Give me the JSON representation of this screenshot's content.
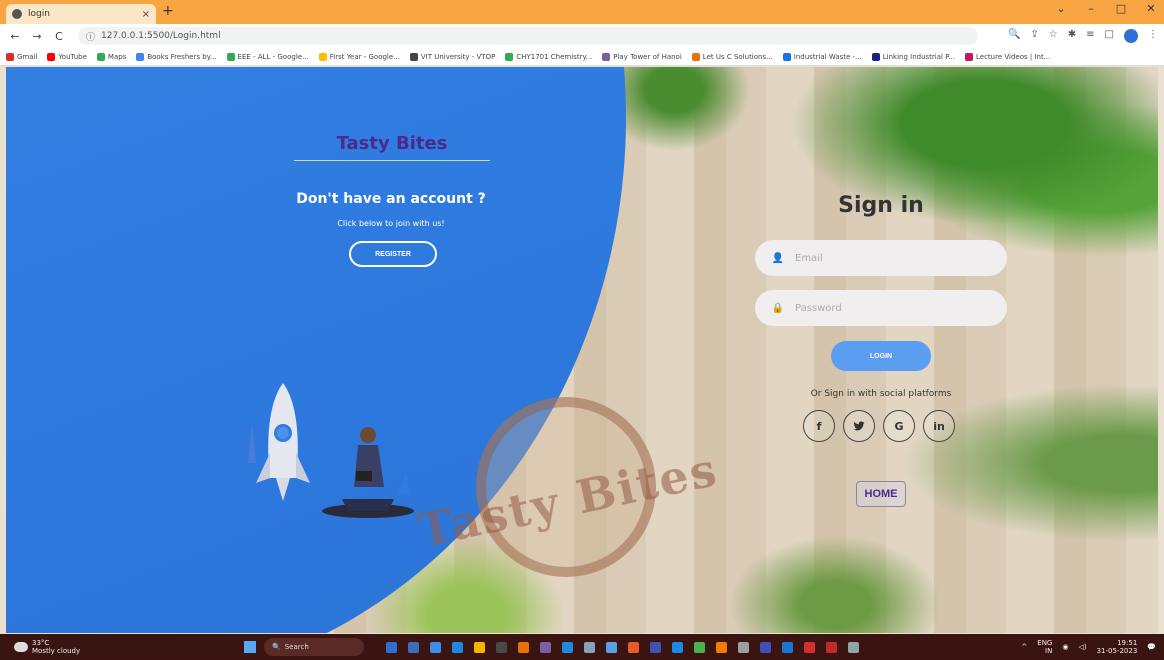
{
  "browser": {
    "tab_title": "login",
    "tab_close": "×",
    "new_tab": "+",
    "url": "127.0.0.1:5500/Login.html",
    "window_controls": [
      "⌄",
      "–",
      "□",
      "✕"
    ],
    "bookmarks": [
      {
        "label": "Gmail",
        "color": "#d93025"
      },
      {
        "label": "YouTube",
        "color": "#ff0000"
      },
      {
        "label": "Maps",
        "color": "#34a853"
      },
      {
        "label": "Books Freshers by...",
        "color": "#4285f4"
      },
      {
        "label": "EEE - ALL - Google...",
        "color": "#34a853"
      },
      {
        "label": "First Year - Google...",
        "color": "#fbbc04"
      },
      {
        "label": "VIT University - VTOP",
        "color": "#444444"
      },
      {
        "label": "CHY1701 Chemistry...",
        "color": "#34a853"
      },
      {
        "label": "Play Tower of Hanoi",
        "color": "#7b5ea7"
      },
      {
        "label": "Let Us C Solutions...",
        "color": "#e8710a"
      },
      {
        "label": "Industrial Waste -...",
        "color": "#1a73e8"
      },
      {
        "label": "Linking Industrial P...",
        "color": "#1a237e"
      },
      {
        "label": "Lecture Videos | Int...",
        "color": "#c2185b"
      }
    ]
  },
  "left_panel": {
    "brand": "Tasty Bites",
    "heading": "Don't have an account ?",
    "subtext": "Click below to join with us!",
    "register_label": "REGISTER"
  },
  "signin": {
    "title": "Sign in",
    "email_placeholder": "Email",
    "password_placeholder": "Password",
    "login_label": "LOGIN",
    "social_label": "Or Sign in with social platforms",
    "socials": [
      {
        "name": "facebook",
        "glyph": "f"
      },
      {
        "name": "twitter",
        "glyph": "🐦"
      },
      {
        "name": "google",
        "glyph": "G"
      },
      {
        "name": "linkedin",
        "glyph": "in"
      }
    ],
    "home_label": "HOME"
  },
  "watermark": {
    "text": "Tasty Bites"
  },
  "taskbar": {
    "temperature": "33°C",
    "weather": "Mostly cloudy",
    "search": "Search",
    "lang": "ENG",
    "region": "IN",
    "time": "19:51",
    "date": "31-05-2023"
  }
}
